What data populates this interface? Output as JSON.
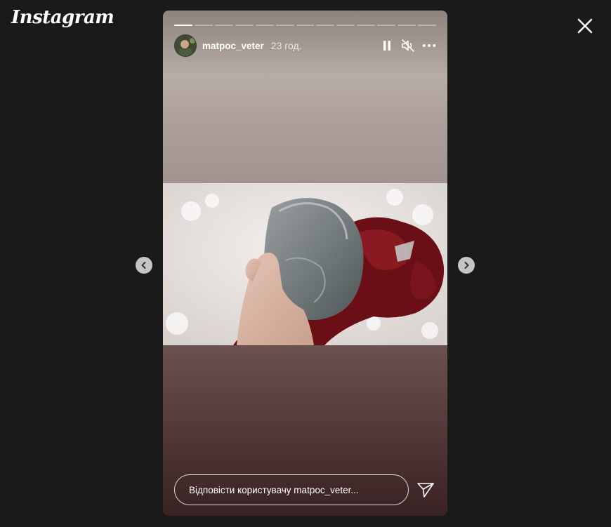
{
  "app": {
    "logo_text": "Instagram"
  },
  "story": {
    "username": "matpoc_veter",
    "time_ago": "23 год.",
    "segments_total": 13,
    "segment_active_index": 0,
    "reply_placeholder": "Відповісти користувачу matpoc_veter..."
  },
  "icons": {
    "close": "close-icon",
    "pause": "pause-icon",
    "mute": "muted-speaker-icon",
    "more": "more-horizontal-icon",
    "prev": "chevron-left-icon",
    "next": "chevron-right-icon",
    "send": "paper-plane-icon"
  },
  "colors": {
    "background": "#1a1a1a",
    "text": "#ffffff"
  }
}
